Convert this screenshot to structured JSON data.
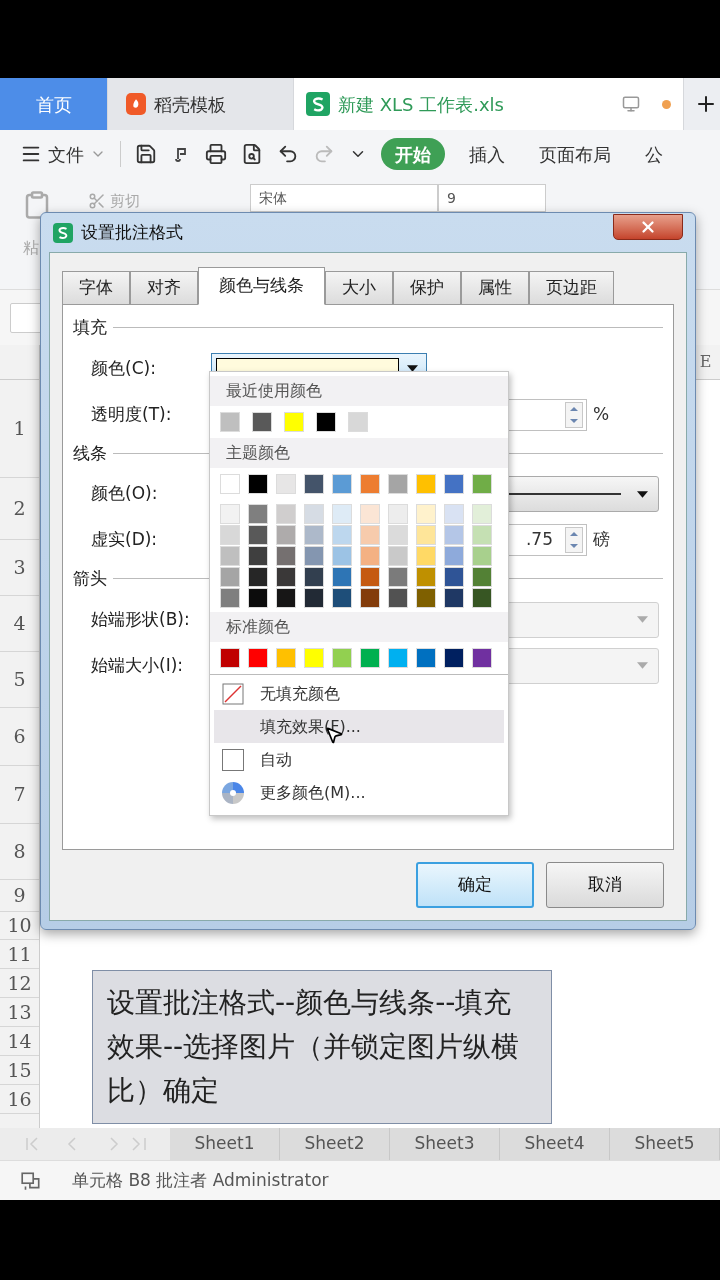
{
  "app_tabs": [
    {
      "label": "首页",
      "kind": "home",
      "selected": false
    },
    {
      "label": "稻壳模板",
      "kind": "docer",
      "selected": false
    },
    {
      "label": "新建 XLS 工作表.xls",
      "kind": "sheet",
      "selected": true
    }
  ],
  "menu": {
    "file": "文件",
    "tabs": [
      {
        "label": "开始",
        "selected": true
      },
      {
        "label": "插入",
        "selected": false
      },
      {
        "label": "页面布局",
        "selected": false
      },
      {
        "label": "公",
        "selected": false
      }
    ]
  },
  "ribbon": {
    "paste": "粘",
    "cut": "剪切",
    "font": "宋体",
    "size": "9"
  },
  "sheet": {
    "column_header": "E",
    "rows": [
      "1",
      "2",
      "3",
      "4",
      "5",
      "6",
      "7",
      "8",
      "9",
      "10",
      "11",
      "12",
      "13",
      "14",
      "15",
      "16"
    ],
    "comment": "设置批注格式--颜色与线条--填充效果--选择图片（并锁定图片纵横比）确定",
    "sheet_tabs": [
      {
        "label": "Sheet1",
        "selected": false
      },
      {
        "label": "Sheet2",
        "selected": false
      },
      {
        "label": "Sheet3",
        "selected": false
      },
      {
        "label": "Sheet4",
        "selected": false
      },
      {
        "label": "Sheet5",
        "selected": false
      }
    ]
  },
  "status_bar": "单元格 B8 批注者 Administrator",
  "dialog": {
    "title": "设置批注格式",
    "tabs": [
      {
        "label": "字体",
        "selected": false
      },
      {
        "label": "对齐",
        "selected": false
      },
      {
        "label": "颜色与线条",
        "selected": true
      },
      {
        "label": "大小",
        "selected": false
      },
      {
        "label": "保护",
        "selected": false
      },
      {
        "label": "属性",
        "selected": false
      },
      {
        "label": "页边距",
        "selected": false
      }
    ],
    "sections": [
      {
        "title": "填充",
        "fields": [
          {
            "label": "颜色(C):",
            "kind": "color",
            "color": "#fffbdd"
          },
          {
            "label": "透明度(T):",
            "kind": "spin",
            "unit": "%"
          }
        ]
      },
      {
        "title": "线条",
        "fields": [
          {
            "label": "颜色(O):",
            "kind": "line"
          },
          {
            "label": "虚实(D):",
            "kind": "spin",
            "value": ".75",
            "unit": "磅"
          }
        ]
      },
      {
        "title": "箭头",
        "fields": [
          {
            "label": "始端形状(B):",
            "kind": "select",
            "disabled": true
          },
          {
            "label": "始端大小(I):",
            "kind": "select",
            "disabled": true
          }
        ]
      }
    ],
    "buttons": [
      {
        "label": "确定",
        "default": true
      },
      {
        "label": "取消",
        "default": false
      }
    ]
  },
  "dropdown": {
    "recent_title": "最近使用颜色",
    "recent": [
      {
        "color": "#bfbfbf"
      },
      {
        "color": "#595959"
      },
      {
        "color": "#ffff00"
      },
      {
        "color": "#000000"
      },
      {
        "color": "#d8d8d8"
      }
    ],
    "theme_title": "主题颜色",
    "theme": [
      {
        "color": "#ffffff"
      },
      {
        "color": "#000000"
      },
      {
        "color": "#e7e6e6"
      },
      {
        "color": "#44546a"
      },
      {
        "color": "#5b9bd5"
      },
      {
        "color": "#ed7d31"
      },
      {
        "color": "#a5a5a5"
      },
      {
        "color": "#ffc000"
      },
      {
        "color": "#4472c4"
      },
      {
        "color": "#70ad47"
      }
    ],
    "tints": [
      [
        {
          "color": "#f2f2f2"
        },
        {
          "color": "#7f7f7f"
        },
        {
          "color": "#d0cece"
        },
        {
          "color": "#d6dce4"
        },
        {
          "color": "#deebf6"
        },
        {
          "color": "#fbe5d5"
        },
        {
          "color": "#ededed"
        },
        {
          "color": "#fff2cc"
        },
        {
          "color": "#d9e2f3"
        },
        {
          "color": "#e2efd9"
        }
      ],
      [
        {
          "color": "#d8d8d8"
        },
        {
          "color": "#595959"
        },
        {
          "color": "#aeabab"
        },
        {
          "color": "#adb9ca"
        },
        {
          "color": "#bdd7ee"
        },
        {
          "color": "#f7cbac"
        },
        {
          "color": "#dbdbdb"
        },
        {
          "color": "#fee599"
        },
        {
          "color": "#b4c6e7"
        },
        {
          "color": "#c5e0b3"
        }
      ],
      [
        {
          "color": "#bfbfbf"
        },
        {
          "color": "#3f3f3f"
        },
        {
          "color": "#757070"
        },
        {
          "color": "#8496b0"
        },
        {
          "color": "#9cc3e5"
        },
        {
          "color": "#f4b183"
        },
        {
          "color": "#c9c9c9"
        },
        {
          "color": "#ffd965"
        },
        {
          "color": "#8eaadb"
        },
        {
          "color": "#a8d08d"
        }
      ],
      [
        {
          "color": "#a5a5a5"
        },
        {
          "color": "#262626"
        },
        {
          "color": "#3a3838"
        },
        {
          "color": "#323f4f"
        },
        {
          "color": "#2e75b5"
        },
        {
          "color": "#c55a11"
        },
        {
          "color": "#7b7b7b"
        },
        {
          "color": "#bf9000"
        },
        {
          "color": "#2f5496"
        },
        {
          "color": "#538135"
        }
      ],
      [
        {
          "color": "#7f7f7f"
        },
        {
          "color": "#0c0c0c"
        },
        {
          "color": "#171616"
        },
        {
          "color": "#222a35"
        },
        {
          "color": "#1e4e79"
        },
        {
          "color": "#833c0b"
        },
        {
          "color": "#525252"
        },
        {
          "color": "#7f6000"
        },
        {
          "color": "#1f3864"
        },
        {
          "color": "#375623"
        }
      ]
    ],
    "standard_title": "标准颜色",
    "standard": [
      {
        "color": "#c00000"
      },
      {
        "color": "#ff0000"
      },
      {
        "color": "#ffc000"
      },
      {
        "color": "#ffff00"
      },
      {
        "color": "#92d050"
      },
      {
        "color": "#00b050"
      },
      {
        "color": "#00b0f0"
      },
      {
        "color": "#0070c0"
      },
      {
        "color": "#002060"
      },
      {
        "color": "#7030a0"
      }
    ],
    "items": [
      {
        "label": "无填充颜色",
        "kind": "none",
        "selected": false
      },
      {
        "label": "填充效果(F)...",
        "kind": "effects",
        "selected": true
      },
      {
        "label": "自动",
        "kind": "auto",
        "selected": false
      },
      {
        "label": "更多颜色(M)...",
        "kind": "more",
        "selected": false
      }
    ]
  }
}
